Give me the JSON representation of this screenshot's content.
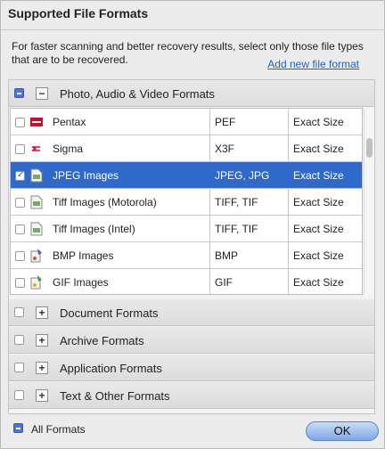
{
  "dialog": {
    "title": "Supported File Formats",
    "description": "For faster scanning and better recovery results, select only those file types that are to be recovered.",
    "add_link": "Add new file format"
  },
  "groups": [
    {
      "label": "Photo, Audio & Video Formats",
      "expanded": true,
      "check": "partial"
    },
    {
      "label": "Document Formats",
      "expanded": false,
      "check": "none"
    },
    {
      "label": "Archive Formats",
      "expanded": false,
      "check": "none"
    },
    {
      "label": "Application Formats",
      "expanded": false,
      "check": "none"
    },
    {
      "label": "Text & Other Formats",
      "expanded": false,
      "check": "none"
    }
  ],
  "expander_symbols": {
    "expanded": "−",
    "collapsed": "+"
  },
  "formats": [
    {
      "name": "Pentax",
      "ext": "PEF",
      "size": "Exact Size",
      "checked": false,
      "selected": false,
      "icon": "pentax-logo-icon"
    },
    {
      "name": "Sigma",
      "ext": "X3F",
      "size": "Exact Size",
      "checked": false,
      "selected": false,
      "icon": "sigma-logo-icon"
    },
    {
      "name": "JPEG Images",
      "ext": "JPEG, JPG",
      "size": "Exact Size",
      "checked": true,
      "selected": true,
      "icon": "image-file-icon"
    },
    {
      "name": "Tiff Images (Motorola)",
      "ext": "TIFF, TIF",
      "size": "Exact Size",
      "checked": false,
      "selected": false,
      "icon": "image-file-icon"
    },
    {
      "name": "Tiff Images (Intel)",
      "ext": "TIFF, TIF",
      "size": "Exact Size",
      "checked": false,
      "selected": false,
      "icon": "image-file-icon"
    },
    {
      "name": "BMP Images",
      "ext": "BMP",
      "size": "Exact Size",
      "checked": false,
      "selected": false,
      "icon": "paint-file-icon"
    },
    {
      "name": "GIF Images",
      "ext": "GIF",
      "size": "Exact Size",
      "checked": false,
      "selected": false,
      "icon": "paint-file-icon"
    }
  ],
  "footer": {
    "all_label": "All Formats",
    "all_check": "partial",
    "ok_label": "OK"
  },
  "colors": {
    "selection": "#2f69c9",
    "link": "#1a63c6",
    "checkbox_partial": "#4d73d9"
  }
}
